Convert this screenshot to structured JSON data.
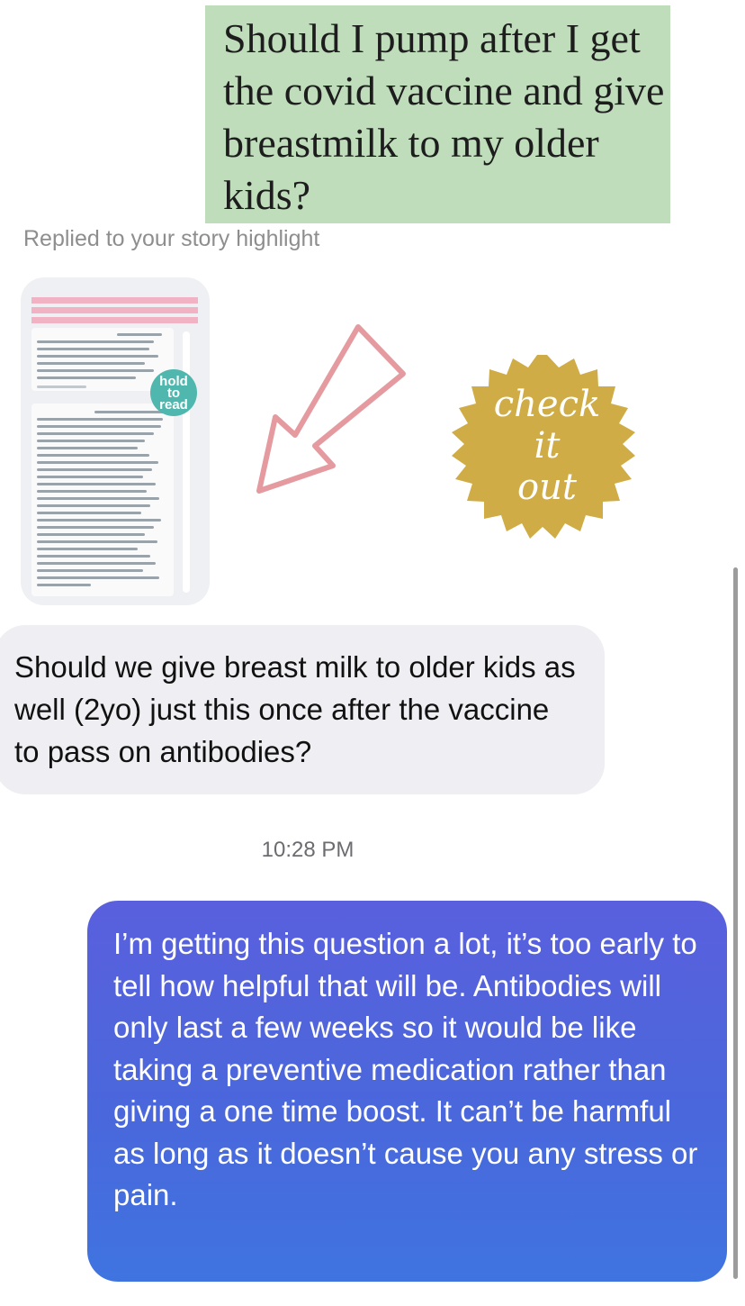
{
  "story_sticker": {
    "headline": "Should I pump after I get the covid vaccine and give breastmilk to my older kids?"
  },
  "reply_context": {
    "label": "Replied to your story highlight"
  },
  "story_thumbnail": {
    "badge_line1": "hold",
    "badge_line2": "to",
    "badge_line3": "read"
  },
  "sticker": {
    "seal_line1": "check",
    "seal_line2": "it",
    "seal_line3": "out",
    "seal_color": "#cfac45",
    "arrow_color": "#e59aa0"
  },
  "messages": {
    "incoming": "Should we give breast milk to older kids as well (2yo) just this once after the vaccine to pass on antibodies?",
    "timestamp": "10:28 PM",
    "outgoing": "I’m getting this question a lot, it’s too early to tell how helpful that will be. Antibodies will only last a few weeks so it would be like taking a preventive medication rather than giving a one time boost. It can’t be harmful as long as it doesn’t cause you any stress or pain."
  }
}
